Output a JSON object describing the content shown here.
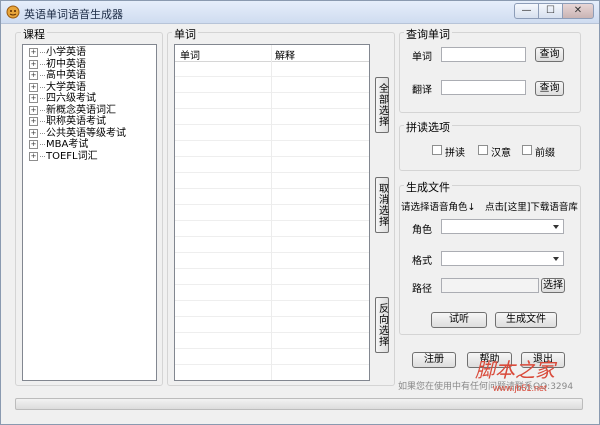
{
  "window": {
    "title": "英语单词语音生成器",
    "min_glyph": "—",
    "max_glyph": "☐",
    "close_glyph": "✕"
  },
  "course": {
    "title": "课程",
    "items": [
      "小学英语",
      "初中英语",
      "高中英语",
      "大学英语",
      "四六级考试",
      "新概念英语词汇",
      "职称英语考试",
      "公共英语等级考试",
      "MBA考试",
      "TOEFL词汇"
    ]
  },
  "words": {
    "title": "单词",
    "columns": [
      "单词",
      "解释"
    ]
  },
  "side_buttons": {
    "select_all": "全部选择",
    "deselect": "取消选择",
    "invert": "反向选择"
  },
  "query": {
    "title": "查询单词",
    "word_label": "单词",
    "word_value": "",
    "word_button": "查询",
    "trans_label": "翻译",
    "trans_value": "",
    "trans_button": "查询"
  },
  "options": {
    "title": "拼读选项",
    "spell": "拼读",
    "spell_checked": false,
    "meaning": "汉意",
    "meaning_checked": false,
    "prefix": "前缀",
    "prefix_checked": false
  },
  "gen": {
    "title": "生成文件",
    "hint_role": "请选择语音角色↓",
    "hint_download": "点击[这里]下载语音库",
    "role_label": "角色",
    "role_value": "",
    "format_label": "格式",
    "format_value": "",
    "path_label": "路径",
    "path_value": "",
    "path_button": "选择",
    "listen_button": "试听",
    "generate_button": "生成文件"
  },
  "bottom": {
    "register": "注册",
    "help": "帮助",
    "exit": "退出",
    "status": "如果您在使用中有任何问题请联系QQ:3294",
    "progress": 0
  },
  "watermark": {
    "text": "脚本之家",
    "url": "www.jb51.net",
    "color": "#d94a3a"
  }
}
